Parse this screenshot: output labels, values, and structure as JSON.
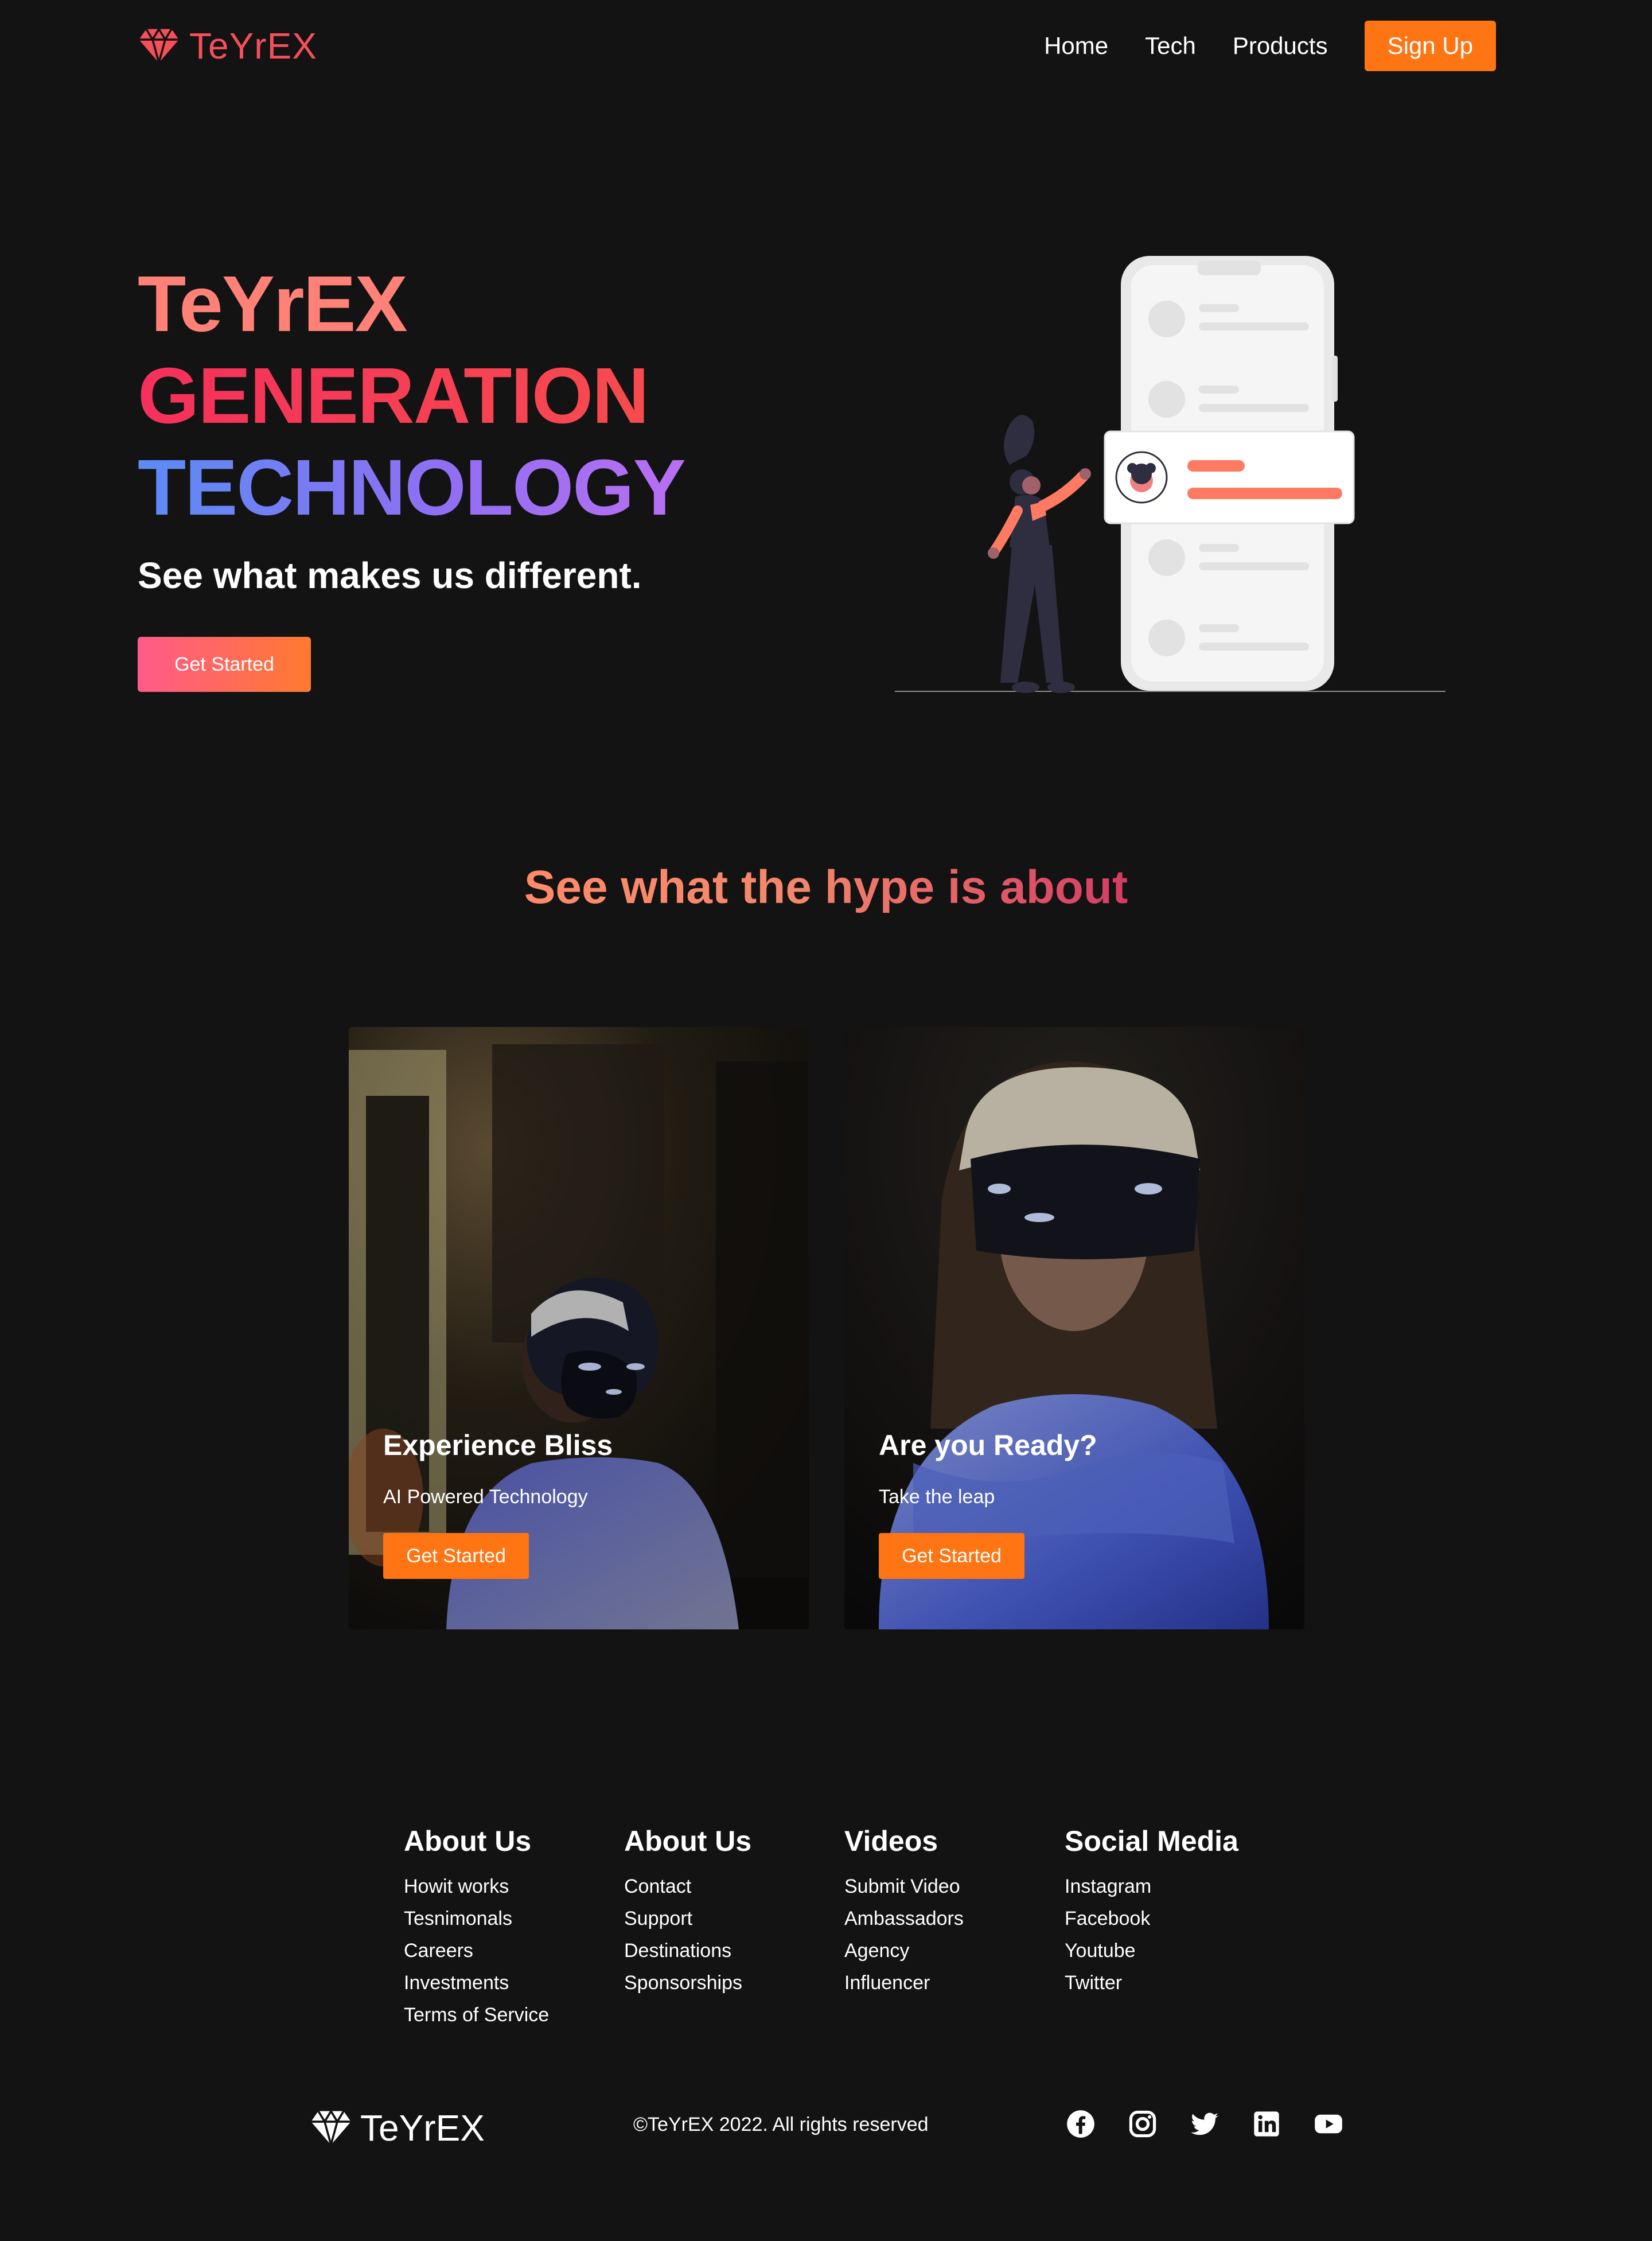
{
  "nav": {
    "logo_text": "TeYrEX",
    "links": [
      "Home",
      "Tech",
      "Products"
    ],
    "signup_label": "Sign Up"
  },
  "hero": {
    "line1": "TeYrEX",
    "line2": "GENERATION",
    "line3": "TECHNOLOGY",
    "subtitle": "See what makes us different.",
    "cta_label": "Get Started"
  },
  "hype": {
    "title": "See what the hype is about",
    "cards": [
      {
        "title": "Experience Bliss",
        "subtitle": "AI Powered Technology",
        "cta": "Get Started"
      },
      {
        "title": "Are you Ready?",
        "subtitle": "Take the leap",
        "cta": "Get Started"
      }
    ]
  },
  "footer": {
    "columns": [
      {
        "heading": "About Us",
        "links": [
          "Howit works",
          "Tesnimonals",
          "Careers",
          "Investments",
          "Terms of Service"
        ]
      },
      {
        "heading": "About Us",
        "links": [
          "Contact",
          "Support",
          "Destinations",
          "Sponsorships"
        ]
      },
      {
        "heading": "Videos",
        "links": [
          "Submit Video",
          "Ambassadors",
          "Agency",
          "Influencer"
        ]
      },
      {
        "heading": "Social Media",
        "links": [
          "Instagram",
          "Facebook",
          "Youtube",
          "Twitter"
        ]
      }
    ],
    "logo_text": "TeYrEX",
    "copyright": "©TeYrEX 2022. All rights reserved",
    "social_icons": [
      "facebook-icon",
      "instagram-icon",
      "twitter-icon",
      "linkedin-icon",
      "youtube-icon"
    ]
  },
  "colors": {
    "background": "#131313",
    "accent_orange": "#ff7413",
    "brand_red": "#f64f5a",
    "hero_blue": "#5b8cf5",
    "hero_purple": "#b96ff3"
  }
}
